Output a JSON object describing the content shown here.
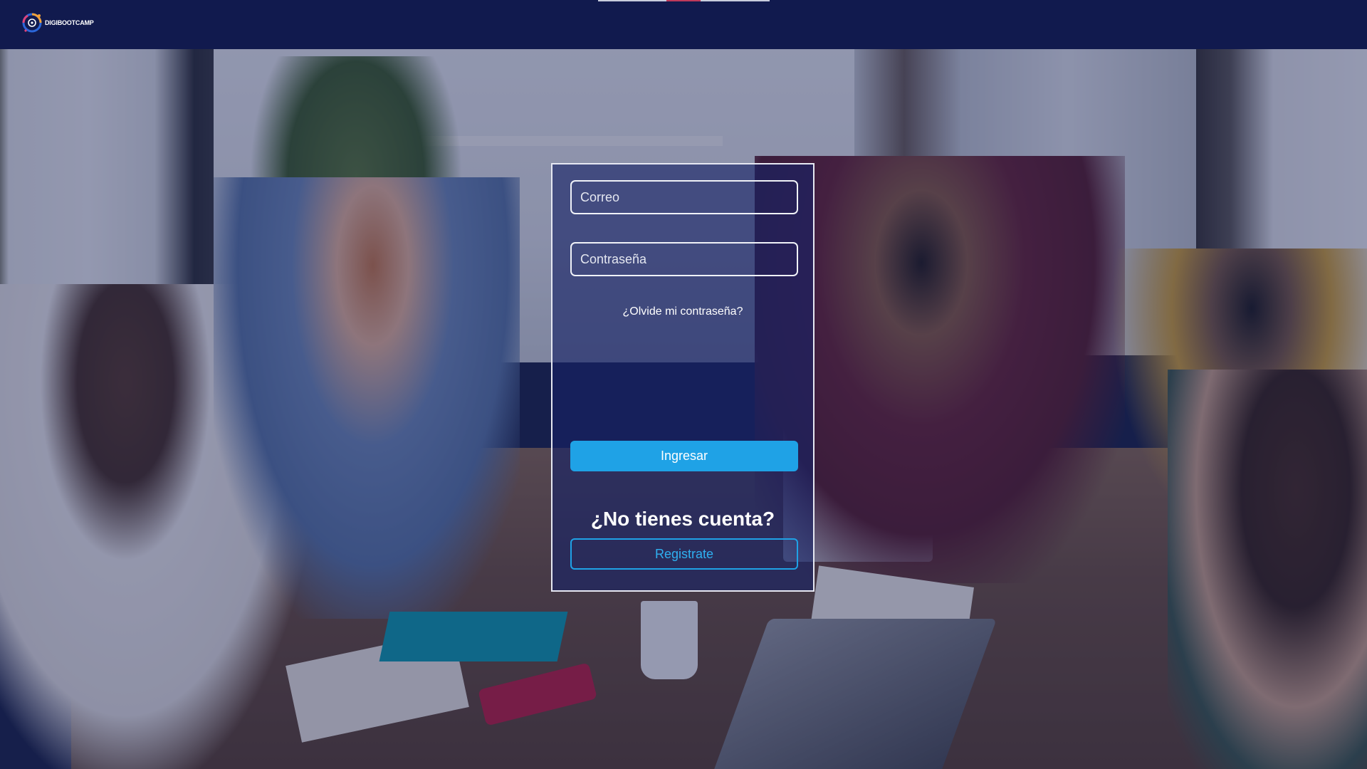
{
  "header": {
    "logo_text": "DIGIBOOTCAMP"
  },
  "login": {
    "email_placeholder": "Correo",
    "password_placeholder": "Contraseña",
    "forgot_link": "¿Olvide mi contraseña?",
    "submit_label": "Ingresar",
    "no_account_text": "¿No tienes cuenta?",
    "register_label": "Registrate"
  },
  "colors": {
    "topbar": "#111a4e",
    "accent": "#1fa2e6",
    "panel_overlay": "#162266"
  },
  "icons": {
    "logo": "digibootcamp-logo-icon"
  }
}
